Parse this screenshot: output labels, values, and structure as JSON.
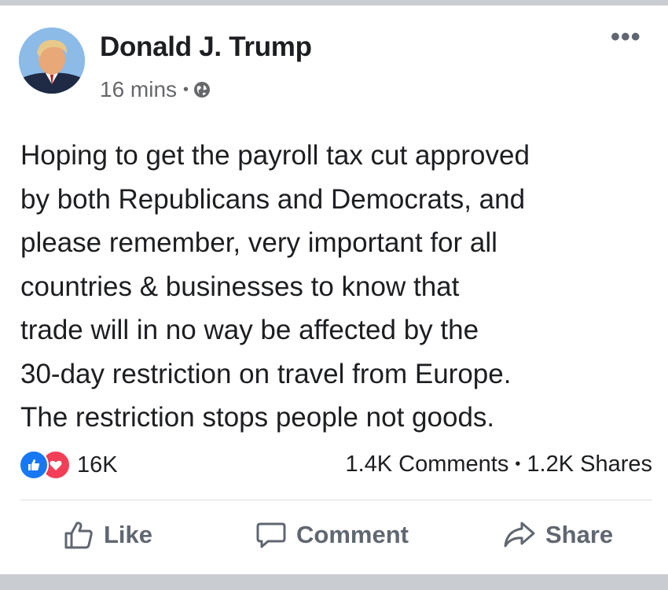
{
  "post": {
    "author": "Donald J. Trump",
    "time": "16 mins",
    "meta_separator": "•",
    "privacy_icon": "globe-icon",
    "more_label": "•••",
    "text": "Hoping to get the payroll tax cut approved\nby both Republicans and Democrats, and\nplease remember, very important for all\ncountries & businesses to know that\ntrade will in no way be affected by the\n30-day restriction on travel from Europe.\nThe restriction stops people not goods."
  },
  "engagement": {
    "reaction_icons": [
      "like-reaction-icon",
      "love-reaction-icon"
    ],
    "reactions_count": "16K",
    "comments": "1.4K Comments",
    "separator": "•",
    "shares": "1.2K Shares"
  },
  "actions": {
    "like_label": "Like",
    "comment_label": "Comment",
    "share_label": "Share"
  },
  "colors": {
    "like_blue": "#1877f2",
    "love_red": "#f33e58",
    "muted_text": "#65676b",
    "frame_gray": "#c9ccd1"
  }
}
